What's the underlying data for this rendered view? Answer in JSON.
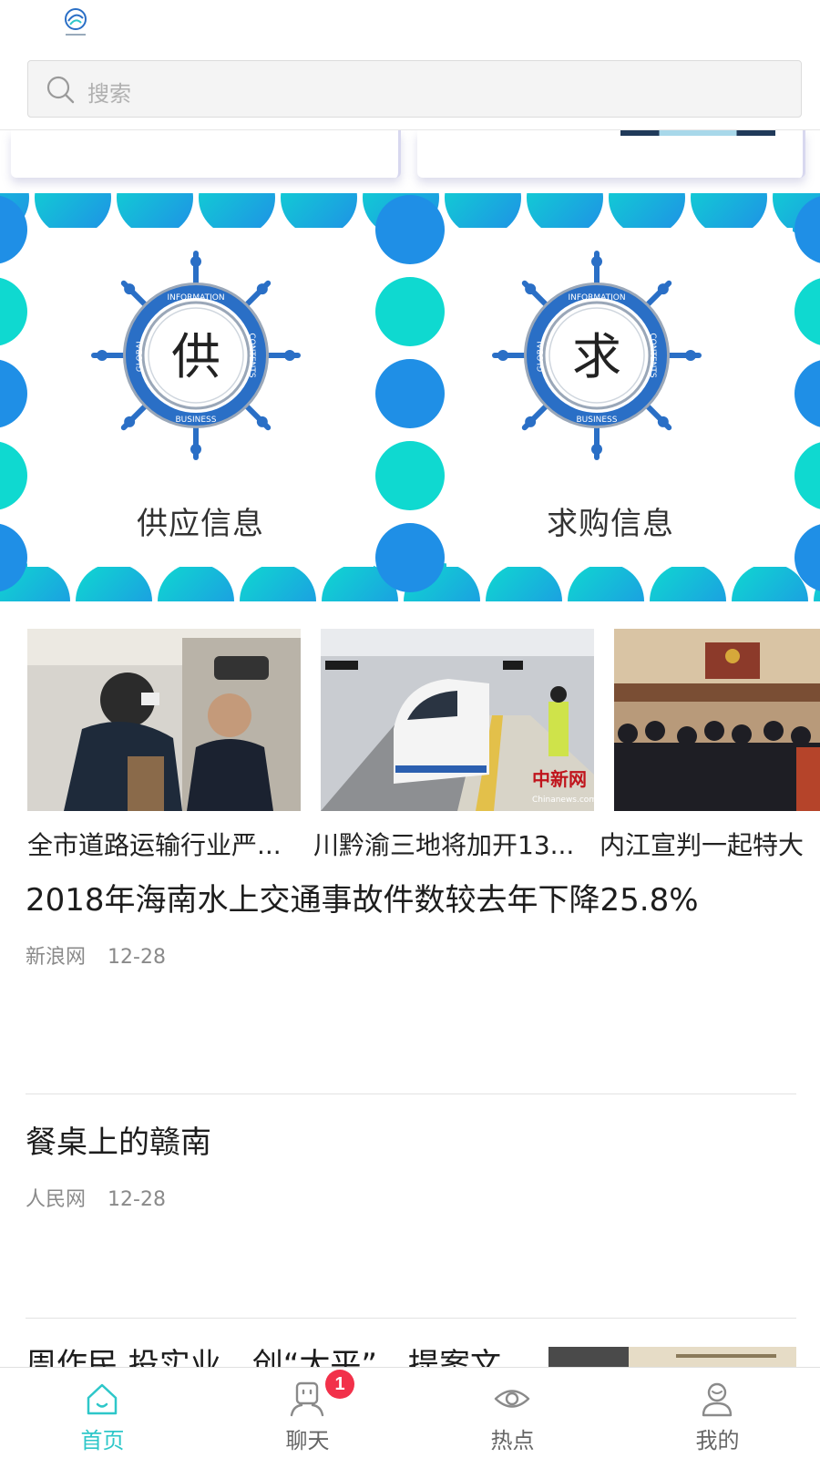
{
  "header": {
    "search": {
      "placeholder": "搜索"
    }
  },
  "banner": {
    "tiles": [
      {
        "glyph": "供",
        "label": "供应信息",
        "wheel_words": [
          "INFORMATION",
          "CONTENTS",
          "BUSINESS",
          "GLOBAL"
        ]
      },
      {
        "glyph": "求",
        "label": "求购信息",
        "wheel_words": [
          "INFORMATION",
          "CONTENTS",
          "BUSINESS",
          "GLOBAL"
        ]
      }
    ],
    "colors": {
      "teal": "#0fd9d0",
      "blue": "#1f8fe6",
      "wheel": "#2a6fc6"
    }
  },
  "carousel": {
    "items": [
      {
        "caption": "全市道路运输行业严..."
      },
      {
        "caption": "川黔渝三地将加开13..."
      },
      {
        "caption": "内江宣判一起特大",
        "watermark": "中新网",
        "watermark_sub": "Chinanews.com"
      }
    ]
  },
  "news": [
    {
      "title": "2018年海南水上交通事故件数较去年下降25.8%",
      "source": "新浪网",
      "date": "12-28"
    },
    {
      "title": "餐桌上的赣南",
      "source": "人民网",
      "date": "12-28"
    },
    {
      "title": "周作民 投实业，创“太平”，提案文"
    }
  ],
  "bottom_nav": [
    {
      "label": "首页",
      "icon": "home-icon",
      "active": true
    },
    {
      "label": "聊天",
      "icon": "chat-icon",
      "badge": "1"
    },
    {
      "label": "热点",
      "icon": "eye-icon"
    },
    {
      "label": "我的",
      "icon": "profile-icon"
    }
  ],
  "colors": {
    "accent": "#2ec7c9",
    "badge": "#f2314a"
  }
}
